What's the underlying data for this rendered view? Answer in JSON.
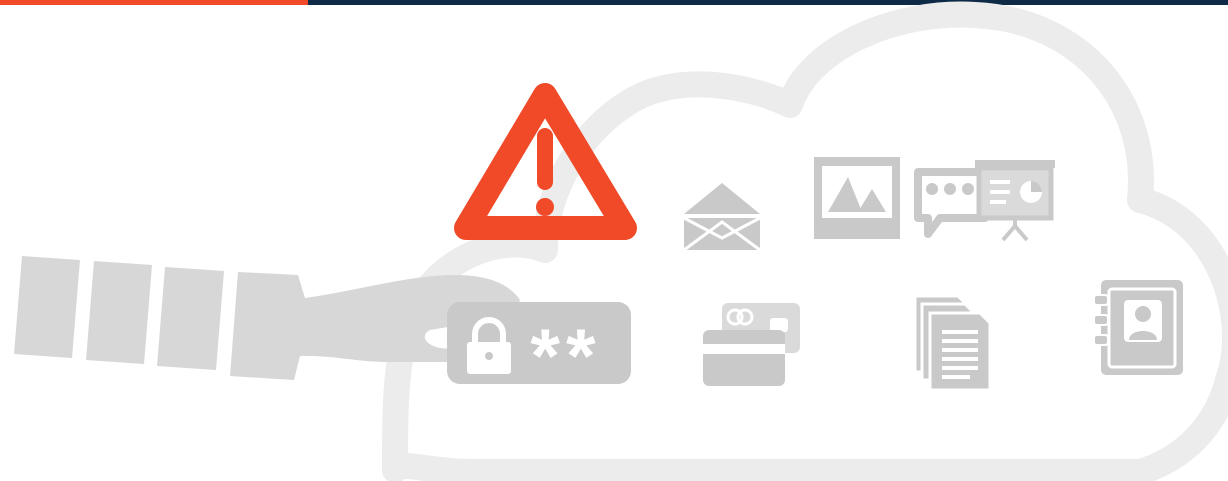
{
  "colors": {
    "accent": "#f04a29",
    "dark": "#0d2b47",
    "cloud": "#ececec",
    "icon": "#c9c9c9",
    "icon_light": "#dadada",
    "white": "#ffffff"
  },
  "illustration": {
    "topbar": {
      "segments": [
        "accent",
        "dark"
      ]
    },
    "warning": {
      "icon": "warning-triangle-icon"
    },
    "password_field": {
      "icon": "lock-icon",
      "text": "**"
    },
    "cloud_icons": [
      "email-envelope-icon",
      "image-icon",
      "chat-bubble-icon",
      "presentation-icon",
      "credit-card-icon",
      "documents-icon",
      "contacts-book-icon"
    ],
    "hand": {
      "icon": "hand-arm-icon"
    }
  }
}
